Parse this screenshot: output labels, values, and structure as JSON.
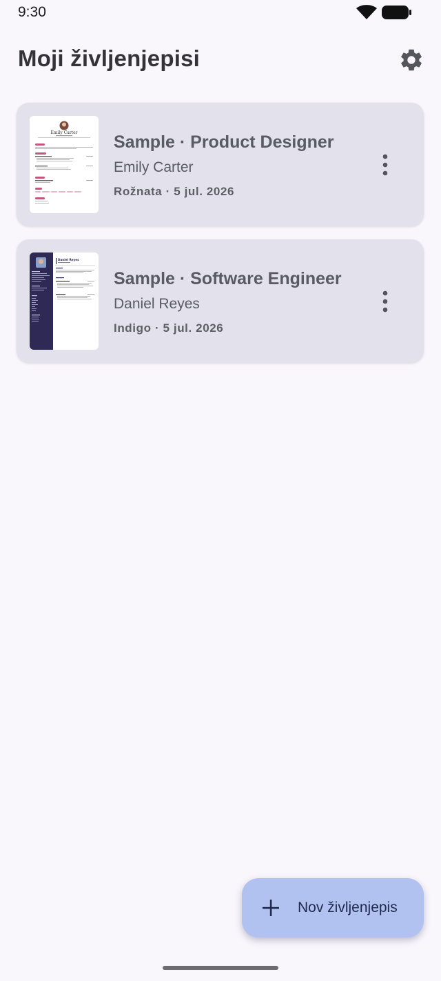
{
  "status_bar": {
    "time": "9:30"
  },
  "header": {
    "title": "Moji življenjepisi",
    "settings_icon": "gear-icon"
  },
  "resumes": [
    {
      "title": "Sample · Product Designer",
      "name": "Emily Carter",
      "meta": "Rožnata · 5 jul. 2026",
      "preview": {
        "name": "Emily Carter",
        "accent": "#c2577c"
      },
      "menu_icon": "more-vert-icon"
    },
    {
      "title": "Sample · Software Engineer",
      "name": "Daniel Reyes",
      "meta": "Indigo · 5 jul. 2026",
      "preview": {
        "name": "Daniel Reyes",
        "accent": "#2f2a55"
      },
      "menu_icon": "more-vert-icon"
    }
  ],
  "fab": {
    "label": "Nov življenjepis",
    "icon": "plus-icon"
  },
  "colors": {
    "background": "#f9f6fc",
    "card": "#e3e2ec",
    "fab": "#b1c2f0",
    "pink_accent": "#c2577c",
    "indigo_accent": "#2f2a55"
  }
}
